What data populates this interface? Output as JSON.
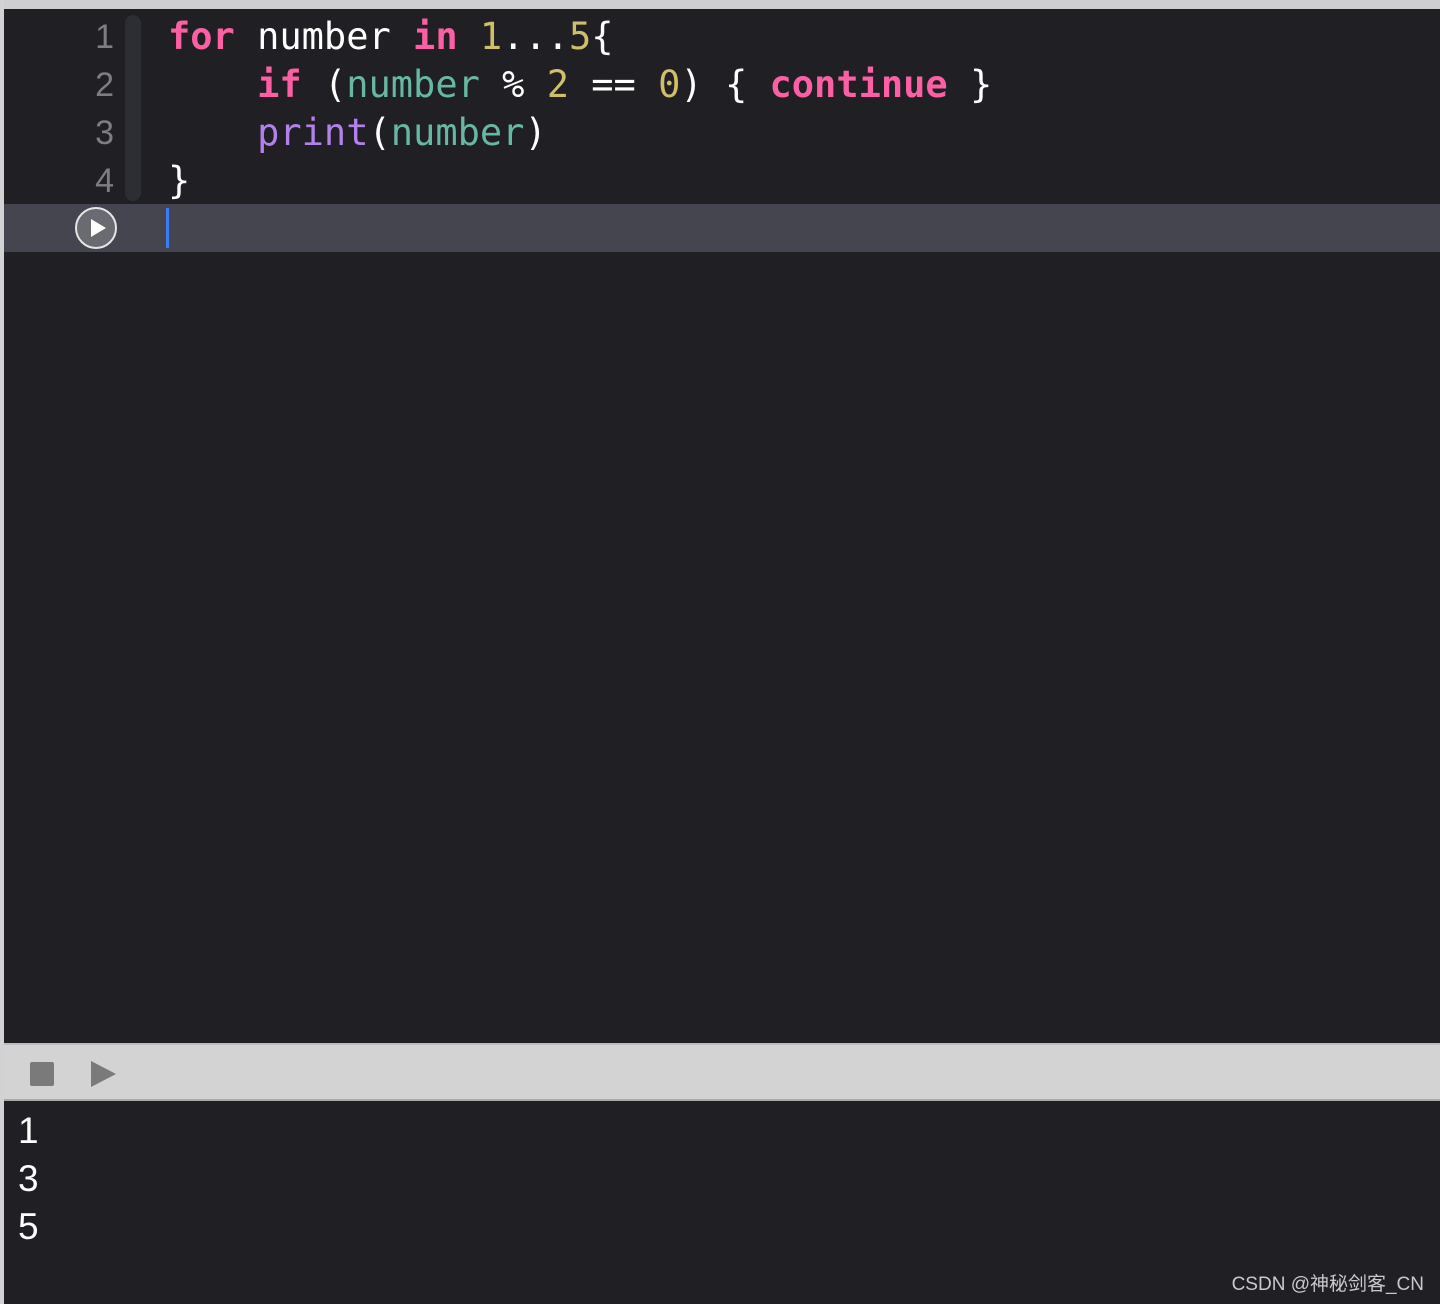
{
  "editor": {
    "lines": [
      {
        "number": "1",
        "tokens": [
          {
            "text": "for",
            "kind": "kw"
          },
          {
            "text": " number ",
            "kind": "plain"
          },
          {
            "text": "in",
            "kind": "kw"
          },
          {
            "text": " ",
            "kind": "plain"
          },
          {
            "text": "1",
            "kind": "num"
          },
          {
            "text": "...",
            "kind": "plain"
          },
          {
            "text": "5",
            "kind": "num"
          },
          {
            "text": "{",
            "kind": "plain"
          }
        ]
      },
      {
        "number": "2",
        "tokens": [
          {
            "text": "    ",
            "kind": "plain"
          },
          {
            "text": "if",
            "kind": "kw"
          },
          {
            "text": " (",
            "kind": "plain"
          },
          {
            "text": "number",
            "kind": "ident"
          },
          {
            "text": " % ",
            "kind": "plain"
          },
          {
            "text": "2",
            "kind": "num"
          },
          {
            "text": " == ",
            "kind": "plain"
          },
          {
            "text": "0",
            "kind": "num"
          },
          {
            "text": ") { ",
            "kind": "plain"
          },
          {
            "text": "continue",
            "kind": "kw"
          },
          {
            "text": " }",
            "kind": "plain"
          }
        ]
      },
      {
        "number": "3",
        "tokens": [
          {
            "text": "    ",
            "kind": "plain"
          },
          {
            "text": "print",
            "kind": "fn"
          },
          {
            "text": "(",
            "kind": "plain"
          },
          {
            "text": "number",
            "kind": "ident"
          },
          {
            "text": ")",
            "kind": "plain"
          }
        ]
      },
      {
        "number": "4",
        "tokens": [
          {
            "text": "}",
            "kind": "plain"
          }
        ]
      }
    ]
  },
  "colors": {
    "keyword": "#fc5fa3",
    "number": "#d0bf69",
    "identifier": "#67b7a4",
    "function": "#b281eb",
    "plain": "#ffffff",
    "cursor": "#3d7bf5"
  },
  "icons": {
    "run_line": "play-circle-icon",
    "stop": "stop-icon",
    "run": "play-icon"
  },
  "console": {
    "output": [
      "1",
      "3",
      "5"
    ]
  },
  "watermark": "CSDN @神秘剑客_CN"
}
